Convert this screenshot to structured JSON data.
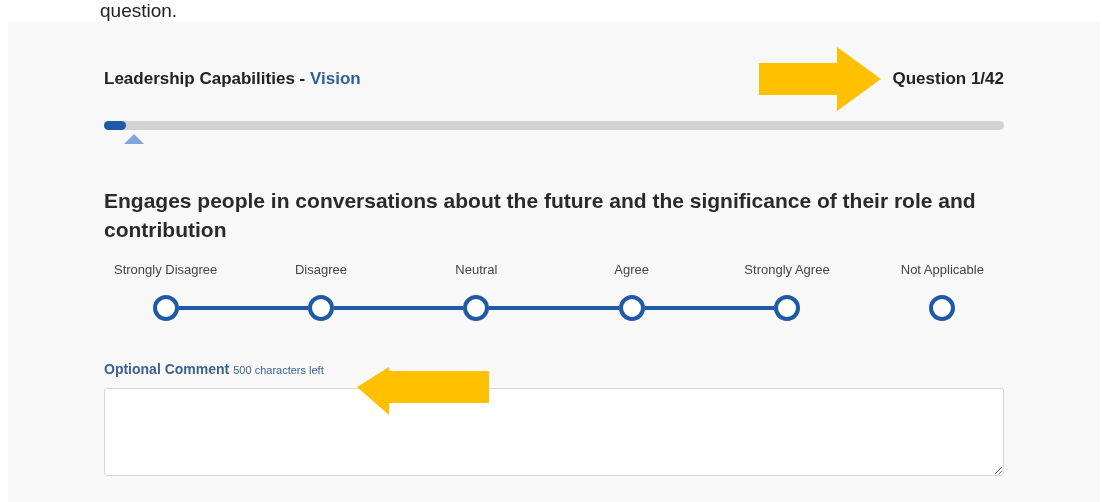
{
  "intro_text": "question.",
  "section": {
    "category": "Leadership Capabilities - ",
    "competency": "Vision"
  },
  "counter": "Question 1/42",
  "progress": {
    "level": 0.024
  },
  "question": "Engages people in conversations about the future and the significance of their role and contribution",
  "options": [
    {
      "label": "Strongly Disagree",
      "kind": "scale",
      "selected": false
    },
    {
      "label": "Disagree",
      "kind": "scale",
      "selected": false
    },
    {
      "label": "Neutral",
      "kind": "scale",
      "selected": false
    },
    {
      "label": "Agree",
      "kind": "scale",
      "selected": false
    },
    {
      "label": "Strongly Agree",
      "kind": "scale",
      "selected": false
    },
    {
      "label": "Not Applicable",
      "kind": "opt_out",
      "selected": false
    }
  ],
  "comment": {
    "label": "Optional Comment",
    "remaining": "500 characters left"
  }
}
